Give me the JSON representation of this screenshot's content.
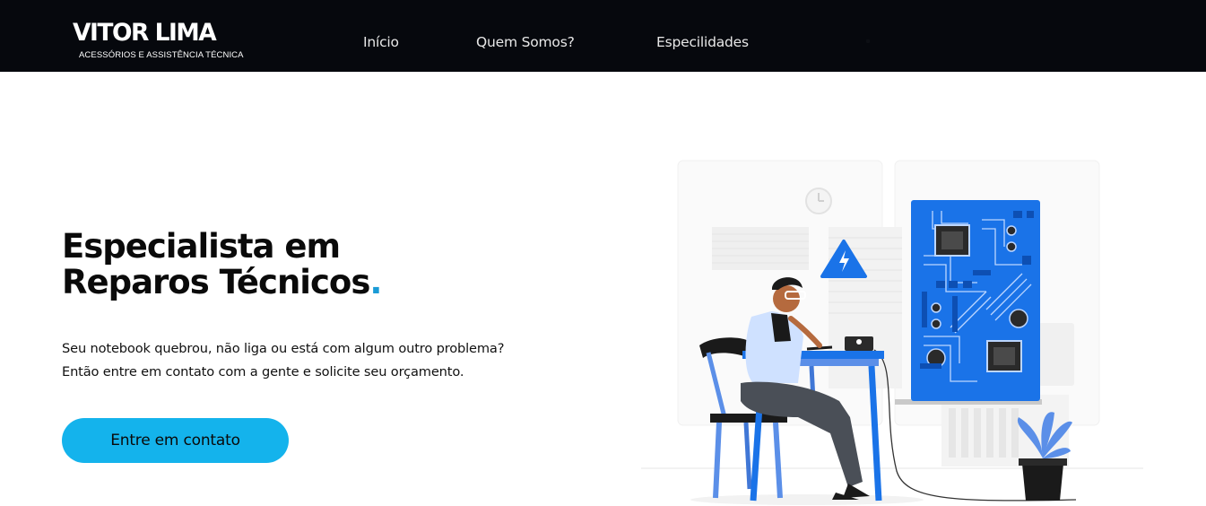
{
  "header": {
    "logo_title": "VITOR LIMA",
    "logo_subtitle": "ACESSÓRIOS E ASSISTÊNCIA TÉCNICA",
    "nav": [
      {
        "label": "Início"
      },
      {
        "label": "Quem Somos?"
      },
      {
        "label": "Especilidades"
      }
    ]
  },
  "hero": {
    "title_line1": "Especialista em",
    "title_line2": "Reparos Técnicos",
    "title_dot": ".",
    "text_line1": "Seu notebook quebrou, não liga ou está com algum outro problema?",
    "text_line2": "Então entre em contato com a gente e solicite seu orçamento.",
    "cta_label": "Entre em contato"
  },
  "colors": {
    "header_bg": "#06080d",
    "accent": "#14b3ec",
    "board_blue": "#1a73e8"
  },
  "illustration": {
    "icons": [
      "clock-icon",
      "warning-lightning-icon",
      "circuit-board",
      "technician",
      "desk",
      "chair",
      "plant"
    ]
  }
}
